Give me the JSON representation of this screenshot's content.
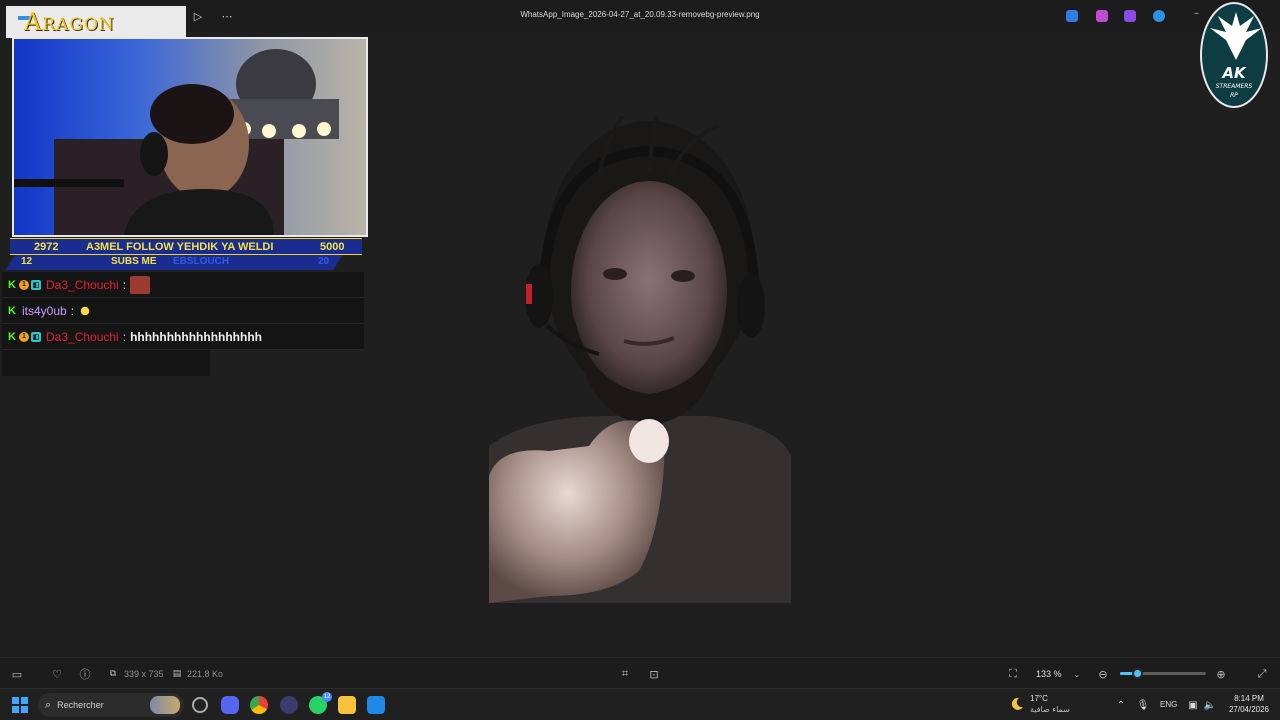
{
  "titlebar": {
    "file_name": "WhatsApp_Image_2026-04-27_at_20.09.33-removebg-preview.png"
  },
  "overlay": {
    "brand": "Aragon",
    "ticker": {
      "left_value": "2972",
      "message": "A3MEL FOLLOW YEHDIK YA WELDI",
      "right_value": "5000",
      "sub_count": "12",
      "sub_label": "SUBS ME",
      "sub_tail": "EBSLOUCH",
      "sub_right": "20"
    },
    "chat": [
      {
        "user": "Da3_Chouchi",
        "user_color": "#e0232e",
        "badges": [
          "k",
          "1",
          "q"
        ],
        "message": "",
        "emote": true
      },
      {
        "user": "its4y0ub",
        "user_color": "#c89bff",
        "badges": [
          "k"
        ],
        "message": "",
        "emote": true
      },
      {
        "user": "Da3_Chouchi",
        "user_color": "#e0232e",
        "badges": [
          "k",
          "1",
          "q"
        ],
        "message": "hhhhhhhhhhhhhhhhhh",
        "emote": false
      }
    ],
    "corner_logo": {
      "title": "AK",
      "line1": "STREAMERS",
      "line2": "RP"
    }
  },
  "bottombar": {
    "dimensions": "339 x 735",
    "file_size": "221.8 Ko",
    "zoom_level": "133 %",
    "zoom_fraction": 0.2
  },
  "taskbar": {
    "search_placeholder": "Rechercher",
    "whatsapp_badge": "12",
    "weather_temp": "17°C",
    "weather_condition": "سماء صافية",
    "language": "ENG",
    "time": "8:14 PM",
    "date": "27/04/2026"
  },
  "colors": {
    "accent": "#4cc2ff",
    "brand_gold": "#f2c81f",
    "ticker_blue": "#1a2d8f",
    "ticker_yellow": "#f6e043"
  }
}
